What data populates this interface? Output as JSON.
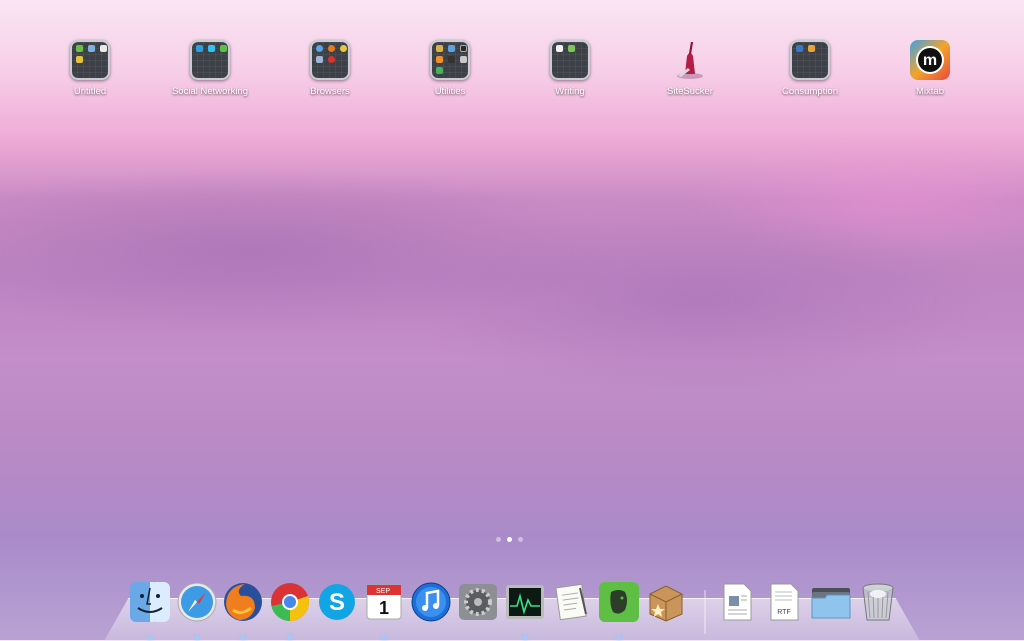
{
  "launchpad": {
    "apps": [
      {
        "label": "Untitled",
        "type": "folder",
        "icon": "folder-icon"
      },
      {
        "label": "Social Networking",
        "type": "folder",
        "icon": "folder-icon"
      },
      {
        "label": "Browsers",
        "type": "folder",
        "icon": "folder-icon"
      },
      {
        "label": "Utilities",
        "type": "folder",
        "icon": "folder-icon"
      },
      {
        "label": "Writing",
        "type": "folder",
        "icon": "folder-icon"
      },
      {
        "label": "SiteSucker",
        "type": "app",
        "icon": "sitesucker-icon"
      },
      {
        "label": "Consumption",
        "type": "folder",
        "icon": "folder-icon"
      },
      {
        "label": "Mixtab",
        "type": "app",
        "icon": "mixtab-icon"
      }
    ],
    "page_indicator": {
      "pages": 3,
      "current": 2
    }
  },
  "dock": {
    "items": [
      {
        "name": "finder",
        "icon": "finder-icon"
      },
      {
        "name": "safari",
        "icon": "safari-icon"
      },
      {
        "name": "firefox",
        "icon": "firefox-icon"
      },
      {
        "name": "chrome",
        "icon": "chrome-icon"
      },
      {
        "name": "skype",
        "icon": "skype-icon"
      },
      {
        "name": "calendar",
        "icon": "calendar-icon",
        "month": "SEP",
        "day": "1"
      },
      {
        "name": "itunes",
        "icon": "itunes-icon"
      },
      {
        "name": "system-preferences",
        "icon": "gear-icon"
      },
      {
        "name": "activity-monitor",
        "icon": "activity-monitor-icon"
      },
      {
        "name": "textedit",
        "icon": "textedit-icon"
      },
      {
        "name": "evernote",
        "icon": "evernote-icon"
      },
      {
        "name": "archive-utility",
        "icon": "archive-box-icon"
      },
      {
        "name": "document",
        "icon": "document-icon"
      },
      {
        "name": "rtf-document",
        "icon": "rtf-document-icon",
        "badge": "RTF"
      },
      {
        "name": "folder-stack",
        "icon": "folder-stack-icon"
      },
      {
        "name": "trash",
        "icon": "trash-icon"
      }
    ]
  },
  "colors": {
    "accent": "#ffffff",
    "run_indicator": "#9ecbff"
  }
}
